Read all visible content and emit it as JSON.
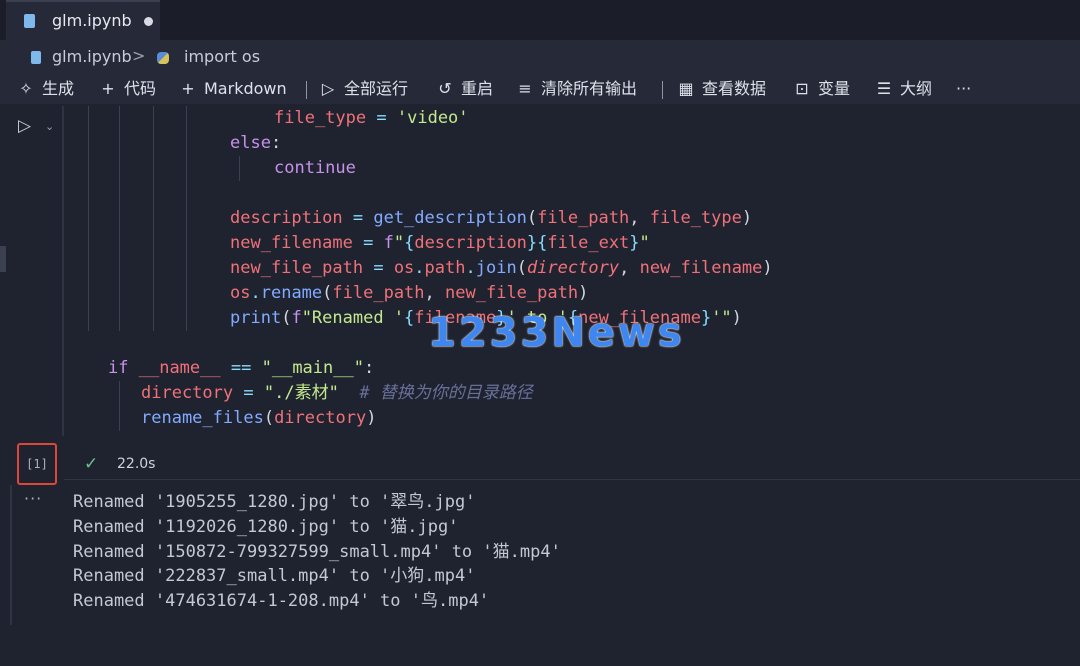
{
  "tab": {
    "label": "glm.ipynb"
  },
  "breadcrumb": {
    "file": "glm.ipynb",
    "separator": ">",
    "symbol": "import os"
  },
  "toolbar": {
    "generate": "生成",
    "code": "代码",
    "markdown": "Markdown",
    "run_all": "全部运行",
    "restart": "重启",
    "clear_outputs": "清除所有输出",
    "view_data": "查看数据",
    "variables": "变量",
    "outline": "大纲",
    "more": "···"
  },
  "cell": {
    "execution_count": "[1]",
    "status_time": "22.0s",
    "code_lines": [
      "file_type = 'video'",
      "else:",
      "continue",
      "",
      "description = get_description(file_path, file_type)",
      "new_filename = f\"{description}{file_ext}\"",
      "new_file_path = os.path.join(directory, new_filename)",
      "os.rename(file_path, new_file_path)",
      "print(f\"Renamed '{filename}' to '{new_filename}'\")",
      "",
      "if __name__ == \"__main__\":",
      "directory = \"./素材\"  # 替换为你的目录路径",
      "rename_files(directory)"
    ]
  },
  "output": {
    "ellipsis": "···",
    "lines": [
      "Renamed '1905255_1280.jpg' to '翠鸟.jpg'",
      "Renamed '1192026_1280.jpg' to '猫.jpg'",
      "Renamed '150872-799327599_small.mp4' to '猫.mp4'",
      "Renamed '222837_small.mp4' to '小狗.mp4'",
      "Renamed '474631674-1-208.mp4' to '鸟.mp4'"
    ]
  },
  "watermark": "1233News",
  "colors": {
    "keyword": "#c792ea",
    "variable": "#f07178",
    "string": "#c3e88d",
    "function": "#82aaff",
    "comment": "#697098",
    "highlight_border": "#e0453a"
  }
}
